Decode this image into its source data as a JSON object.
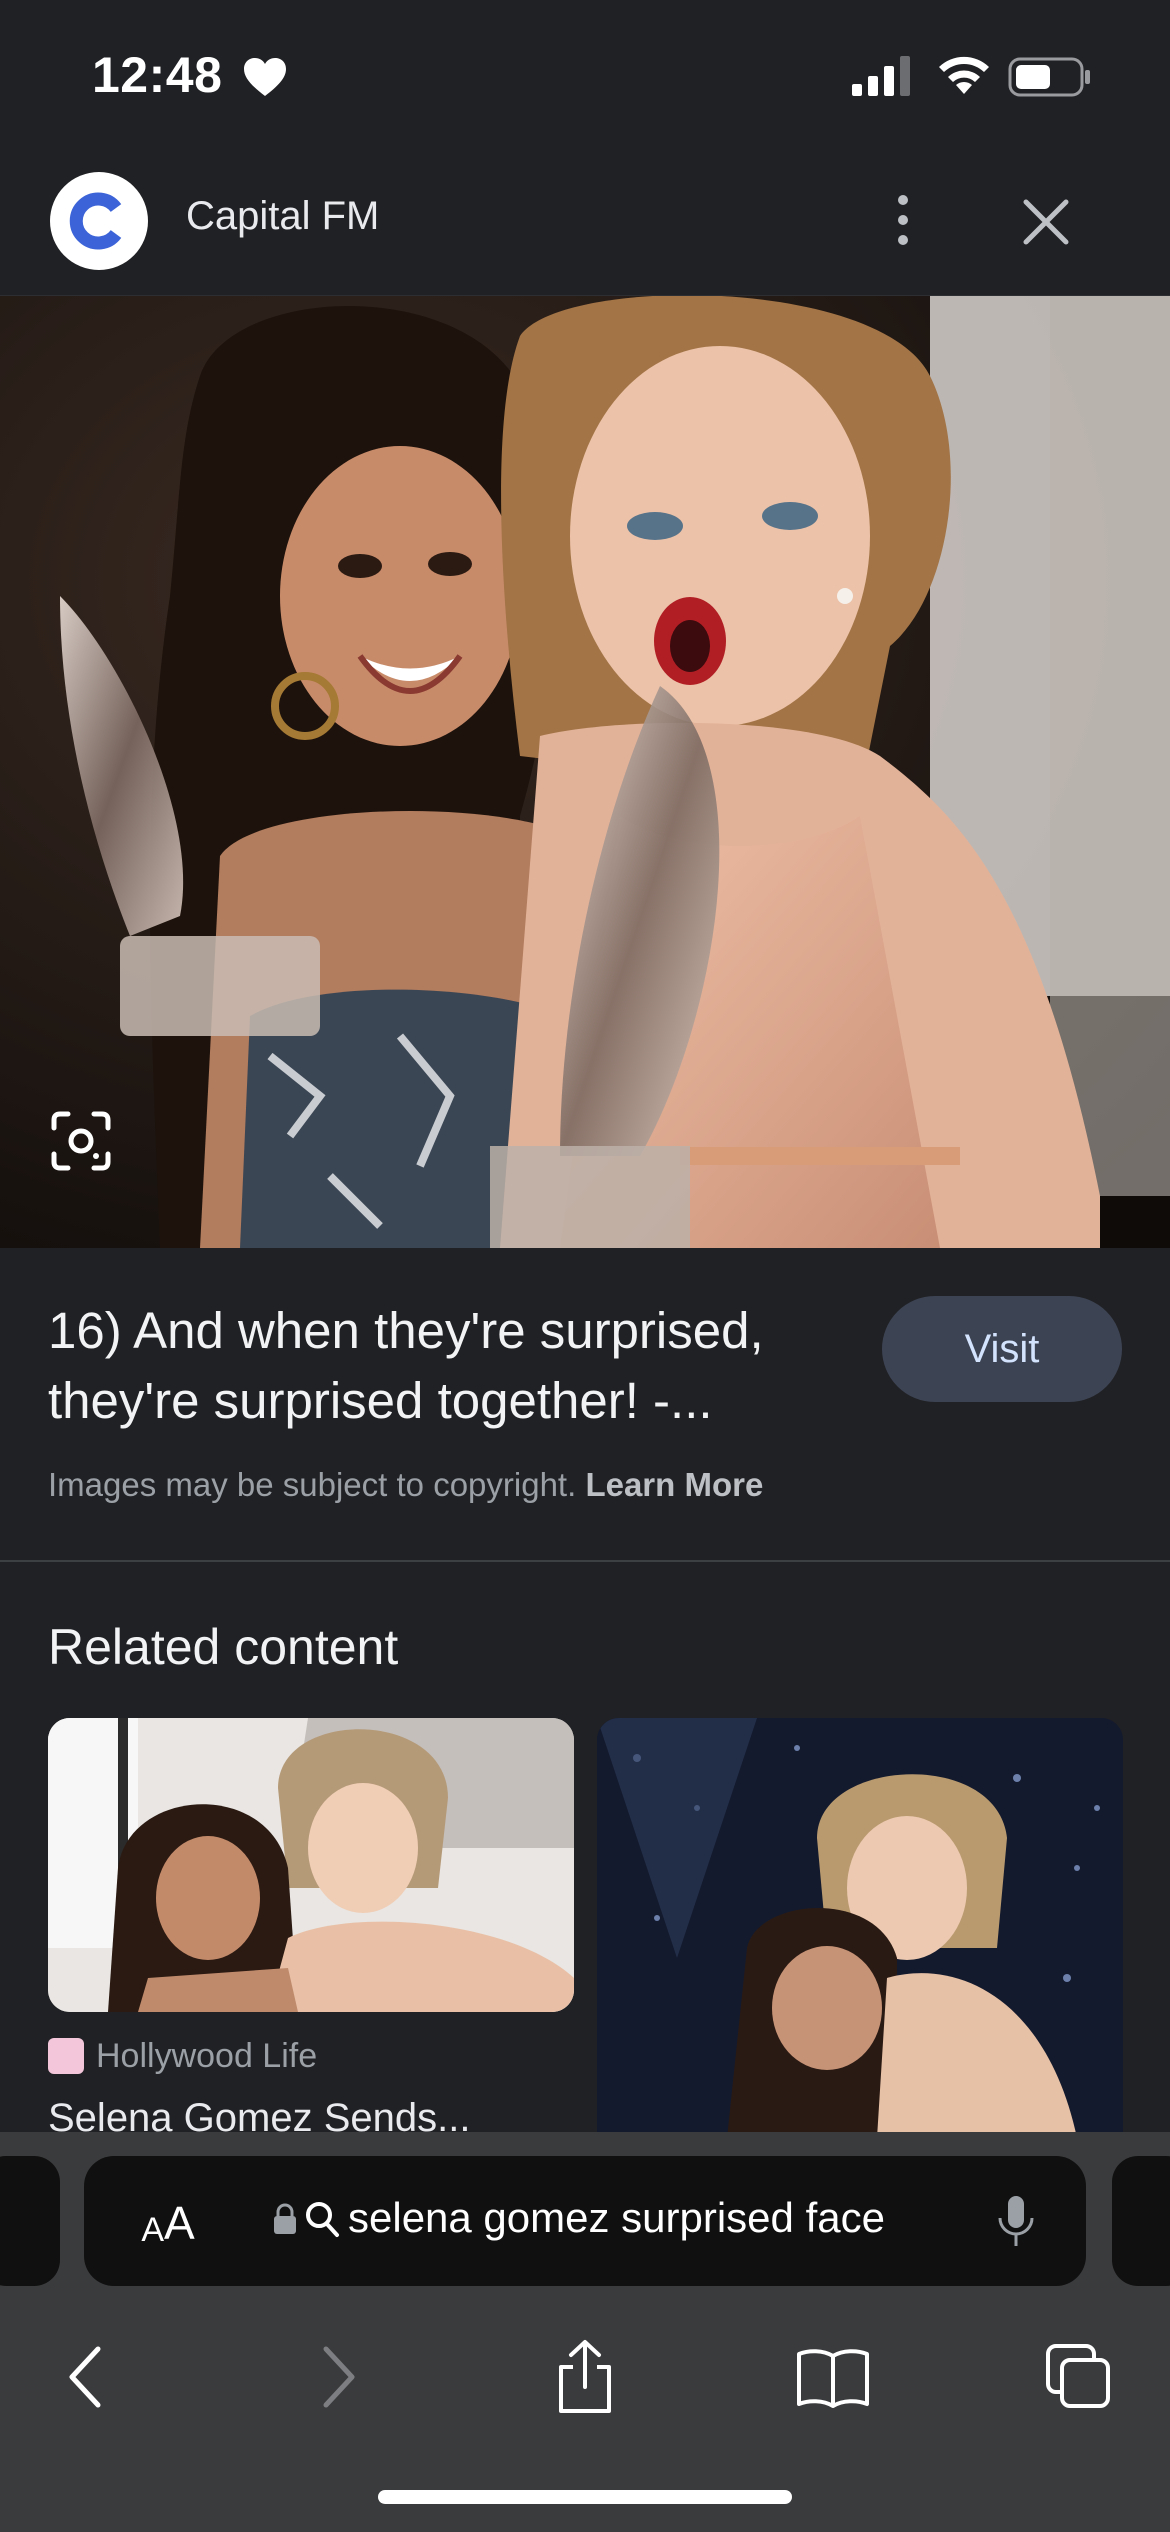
{
  "status_bar": {
    "time": "12:48"
  },
  "header": {
    "site_name": "Capital FM",
    "logo_letter": "C"
  },
  "result": {
    "caption": "16) And when they're surprised, they're surprised together! -...",
    "visit_label": "Visit",
    "copyright_text": "Images may be subject to copyright.",
    "learn_more_label": "Learn More"
  },
  "related": {
    "heading": "Related content",
    "items": [
      {
        "source": "Hollywood Life",
        "title": "Selena Gomez Sends..."
      },
      {
        "source": "",
        "title": ""
      }
    ]
  },
  "browser": {
    "text_size_label_small": "A",
    "text_size_label_big": "A",
    "address_text": "selena gomez surprised face"
  },
  "icons": {
    "heart": "heart-icon",
    "signal": "cellular-signal-icon",
    "wifi": "wifi-icon",
    "battery": "battery-icon",
    "more": "more-vertical-icon",
    "close": "close-icon",
    "lens": "lens-search-icon",
    "lock": "lock-icon",
    "search": "search-icon",
    "mic": "microphone-icon",
    "back": "back-chevron-icon",
    "forward": "forward-chevron-icon",
    "share": "share-icon",
    "bookmarks": "book-icon",
    "tabs": "tabs-icon"
  },
  "colors": {
    "background": "#202124",
    "visit_button": "#3c4353",
    "logo_blue": "#3c64d8",
    "chrome_bar": "#3a3b3d"
  }
}
